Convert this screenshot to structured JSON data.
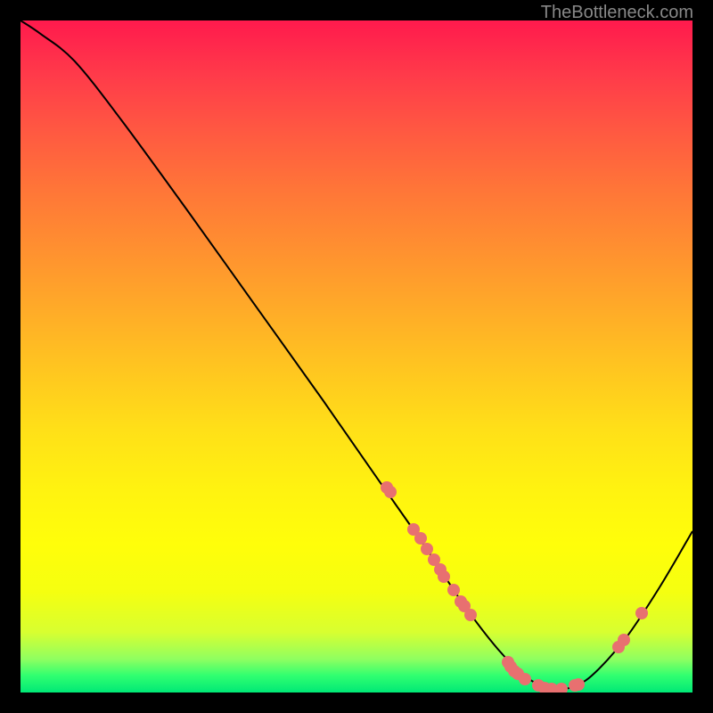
{
  "watermark": "TheBottleneck.com",
  "chart_data": {
    "type": "line",
    "title": "",
    "xlabel": "",
    "ylabel": "",
    "xlim": [
      0,
      100
    ],
    "ylim": [
      0,
      100
    ],
    "series": [
      {
        "name": "curve",
        "points": [
          {
            "x": 0,
            "y": 100
          },
          {
            "x": 3,
            "y": 98
          },
          {
            "x": 8,
            "y": 94
          },
          {
            "x": 15,
            "y": 85.2
          },
          {
            "x": 25,
            "y": 71.5
          },
          {
            "x": 35,
            "y": 57.5
          },
          {
            "x": 45,
            "y": 43.5
          },
          {
            "x": 53,
            "y": 32
          },
          {
            "x": 60,
            "y": 22
          },
          {
            "x": 66,
            "y": 13
          },
          {
            "x": 71,
            "y": 6.5
          },
          {
            "x": 75,
            "y": 2.5
          },
          {
            "x": 78,
            "y": 0.8
          },
          {
            "x": 80,
            "y": 0.4
          },
          {
            "x": 82,
            "y": 0.8
          },
          {
            "x": 85,
            "y": 2.5
          },
          {
            "x": 90,
            "y": 8
          },
          {
            "x": 95,
            "y": 15.5
          },
          {
            "x": 100,
            "y": 24
          }
        ]
      }
    ],
    "scatter_points": [
      {
        "x": 54.5,
        "y": 30.5
      },
      {
        "x": 55.0,
        "y": 29.8
      },
      {
        "x": 58.5,
        "y": 24.3
      },
      {
        "x": 59.5,
        "y": 23.0
      },
      {
        "x": 60.5,
        "y": 21.3
      },
      {
        "x": 61.5,
        "y": 19.8
      },
      {
        "x": 62.5,
        "y": 18.3
      },
      {
        "x": 63.0,
        "y": 17.3
      },
      {
        "x": 64.5,
        "y": 15.3
      },
      {
        "x": 65.5,
        "y": 13.5
      },
      {
        "x": 66.0,
        "y": 12.8
      },
      {
        "x": 67.0,
        "y": 11.5
      },
      {
        "x": 72.5,
        "y": 4.5
      },
      {
        "x": 73.0,
        "y": 3.8
      },
      {
        "x": 73.5,
        "y": 3.2
      },
      {
        "x": 74.0,
        "y": 2.8
      },
      {
        "x": 75.0,
        "y": 2.0
      },
      {
        "x": 77.0,
        "y": 1.0
      },
      {
        "x": 78.0,
        "y": 0.7
      },
      {
        "x": 79.0,
        "y": 0.5
      },
      {
        "x": 80.5,
        "y": 0.5
      },
      {
        "x": 82.5,
        "y": 1.0
      },
      {
        "x": 83.0,
        "y": 1.2
      },
      {
        "x": 89.0,
        "y": 6.7
      },
      {
        "x": 89.8,
        "y": 7.8
      },
      {
        "x": 92.5,
        "y": 11.8
      }
    ],
    "gradient_colors": {
      "top": "#ff1a4d",
      "middle": "#fff310",
      "bottom": "#00e876"
    },
    "dot_color": "#e87070"
  }
}
